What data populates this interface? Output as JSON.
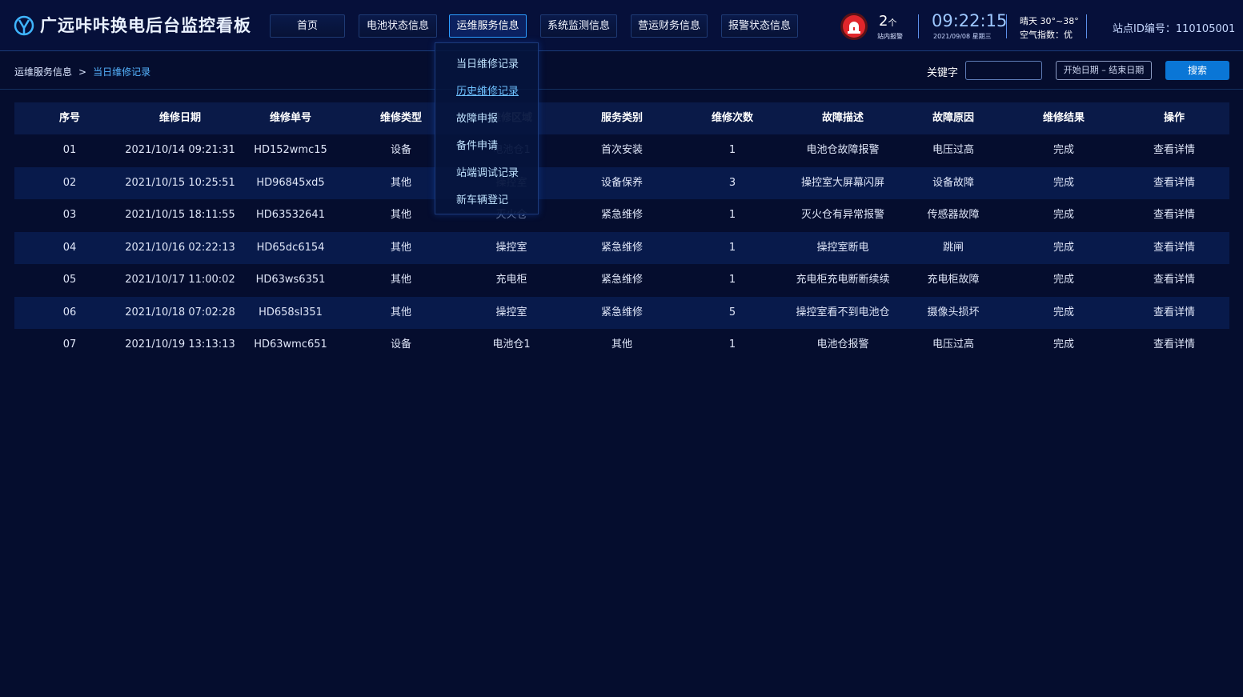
{
  "header": {
    "title": "广远咔咔换电后台监控看板",
    "nav": [
      {
        "label": "首页"
      },
      {
        "label": "电池状态信息"
      },
      {
        "label": "运维服务信息"
      },
      {
        "label": "系统监测信息"
      },
      {
        "label": "营运财务信息"
      },
      {
        "label": "报警状态信息"
      }
    ],
    "alarm": {
      "count": "2",
      "unit": "个",
      "label": "站内报警",
      "color": "#e0262b"
    },
    "clock": {
      "time": "09:22:15",
      "date": "2021/09/08  星期三"
    },
    "weather": {
      "text": "晴天 30°~38°",
      "air": "空气指数：优"
    },
    "station": "站点ID编号：110105001"
  },
  "breadcrumb": {
    "parent": "运维服务信息",
    "separator": ">",
    "current": "当日维修记录"
  },
  "search": {
    "label": "关键字",
    "value": "",
    "date_range": "开始日期 – 结束日期",
    "button": "搜索"
  },
  "dropdown": {
    "items": [
      {
        "label": "当日维修记录"
      },
      {
        "label": "历史维修记录"
      },
      {
        "label": "故障申报"
      },
      {
        "label": "备件申请"
      },
      {
        "label": "站端调试记录"
      },
      {
        "label": "新车辆登记"
      }
    ]
  },
  "table": {
    "columns": [
      "序号",
      "维修日期",
      "维修单号",
      "维修类型",
      "维修区域",
      "服务类别",
      "维修次数",
      "故障描述",
      "故障原因",
      "维修结果",
      "操作"
    ],
    "rows": [
      [
        "01",
        "2021/10/14  09:21:31",
        "HD152wmc15",
        "设备",
        "电池仓1",
        "首次安装",
        "1",
        "电池仓故障报警",
        "电压过高",
        "完成",
        "查看详情"
      ],
      [
        "02",
        "2021/10/15  10:25:51",
        "HD96845xd5",
        "其他",
        "操控室",
        "设备保养",
        "3",
        "操控室大屏幕闪屏",
        "设备故障",
        "完成",
        "查看详情"
      ],
      [
        "03",
        "2021/10/15 18:11:55",
        "HD63532641",
        "其他",
        "灭火仓",
        "紧急维修",
        "1",
        "灭火仓有异常报警",
        "传感器故障",
        "完成",
        "查看详情"
      ],
      [
        "04",
        "2021/10/16  02:22:13",
        "HD65dc6154",
        "其他",
        "操控室",
        "紧急维修",
        "1",
        "操控室断电",
        "跳闸",
        "完成",
        "查看详情"
      ],
      [
        "05",
        "2021/10/17  11:00:02",
        "HD63ws6351",
        "其他",
        "充电柜",
        "紧急维修",
        "1",
        "充电柜充电断断续续",
        "充电柜故障",
        "完成",
        "查看详情"
      ],
      [
        "06",
        "2021/10/18  07:02:28",
        "HD658sl351",
        "其他",
        "操控室",
        "紧急维修",
        "5",
        "操控室看不到电池仓",
        "摄像头损坏",
        "完成",
        "查看详情"
      ],
      [
        "07",
        "2021/10/19  13:13:13",
        "HD63wmc651",
        "设备",
        "电池仓1",
        "其他",
        "1",
        "电池仓报警",
        "电压过高",
        "完成",
        "查看详情"
      ]
    ]
  },
  "colors": {
    "background": "#050d2e",
    "accent": "#2c9cff",
    "button": "#0a76d6"
  }
}
